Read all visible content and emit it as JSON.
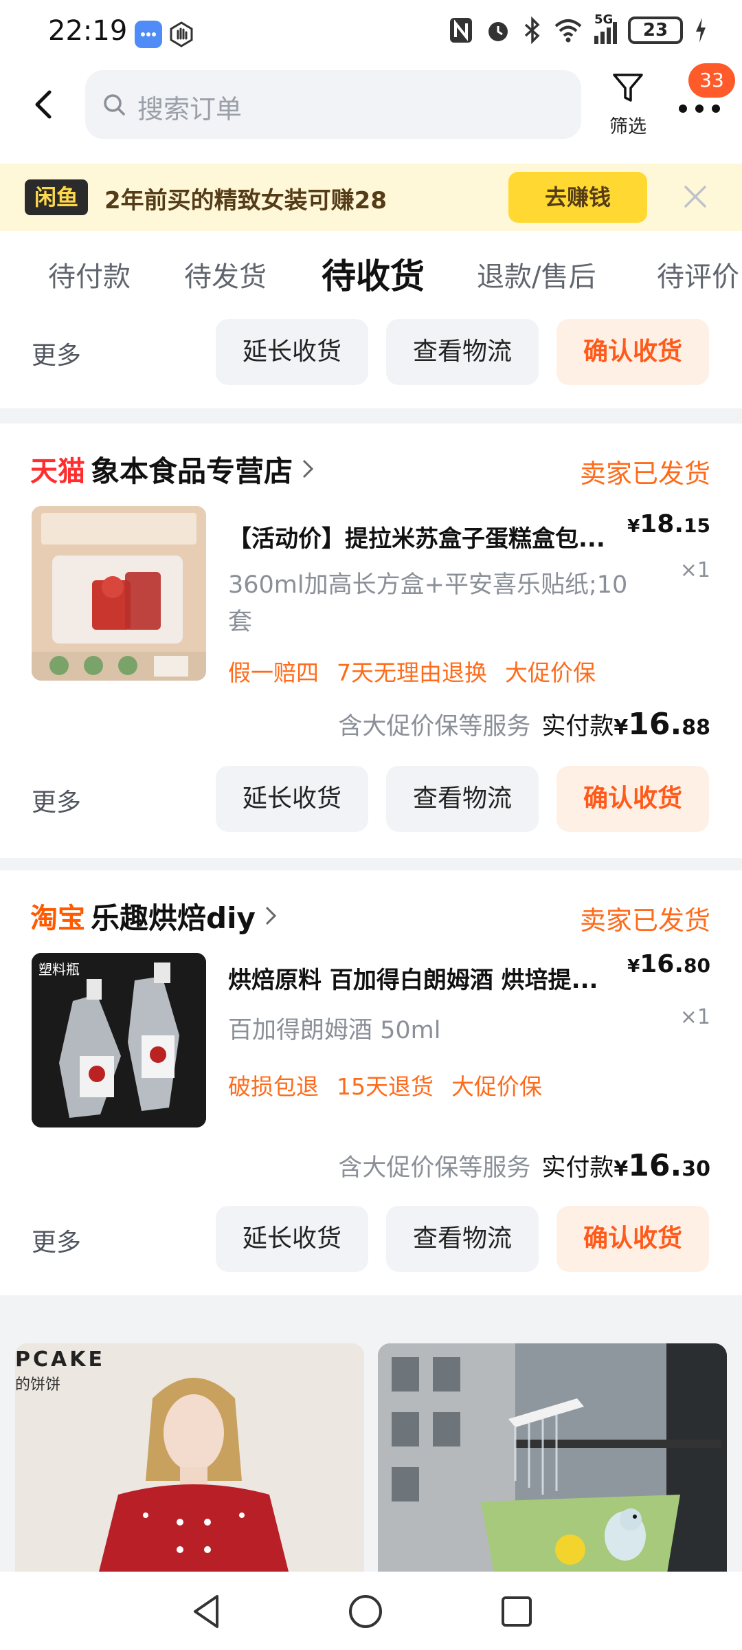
{
  "status_bar": {
    "time": "22:19",
    "battery": "23",
    "network": "5G"
  },
  "header": {
    "search_placeholder": "搜索订单",
    "filter_label": "筛选",
    "badge_count": "33"
  },
  "promo": {
    "logo": "闲鱼",
    "text": "2年前买的精致女装可赚28",
    "button": "去赚钱"
  },
  "tabs": [
    {
      "label": "待付款"
    },
    {
      "label": "待发货"
    },
    {
      "label": "待收货"
    },
    {
      "label": "退款/售后"
    },
    {
      "label": "待评价"
    }
  ],
  "actions": {
    "more": "更多",
    "extend": "延长收货",
    "logistics": "查看物流",
    "confirm": "确认收货"
  },
  "orders": [
    {
      "platform": "天猫",
      "platform_color": "#ff2d2d",
      "shop": "象本食品专营店",
      "status": "卖家已发货",
      "title": "【活动价】提拉米苏盒子蛋糕盒包...",
      "price_sym": "¥",
      "price_int": "18.",
      "price_dec": "15",
      "qty": "×1",
      "spec": "360ml加高长方盒+平安喜乐贴纸;10套",
      "tags": [
        "假一赔四",
        "7天无理由退换",
        "大促价保"
      ],
      "service_note": "含大促价保等服务",
      "paid_label": "实付款",
      "paid_sym": "¥",
      "paid_int": "16.",
      "paid_dec": "88"
    },
    {
      "platform": "淘宝",
      "platform_color": "#ff5a00",
      "shop": "乐趣烘焙diy",
      "status": "卖家已发货",
      "title": "烘焙原料 百加得白朗姆酒 烘培提...",
      "price_sym": "¥",
      "price_int": "16.",
      "price_dec": "80",
      "qty": "×1",
      "spec": "百加得朗姆酒 50ml",
      "tags": [
        "破损包退",
        "15天退货",
        "大促价保"
      ],
      "image_label": "塑料瓶",
      "service_note": "含大促价保等服务",
      "paid_label": "实付款",
      "paid_sym": "¥",
      "paid_int": "16.",
      "paid_dec": "30"
    }
  ],
  "recommendations": {
    "left_brand": "PCAKE",
    "left_sub": "的饼饼"
  },
  "colors": {
    "accent": "#ff5a1a",
    "tag": "#ff6b1a",
    "button_bg": "#f1f3f6",
    "confirm_bg": "#fff0e6"
  }
}
